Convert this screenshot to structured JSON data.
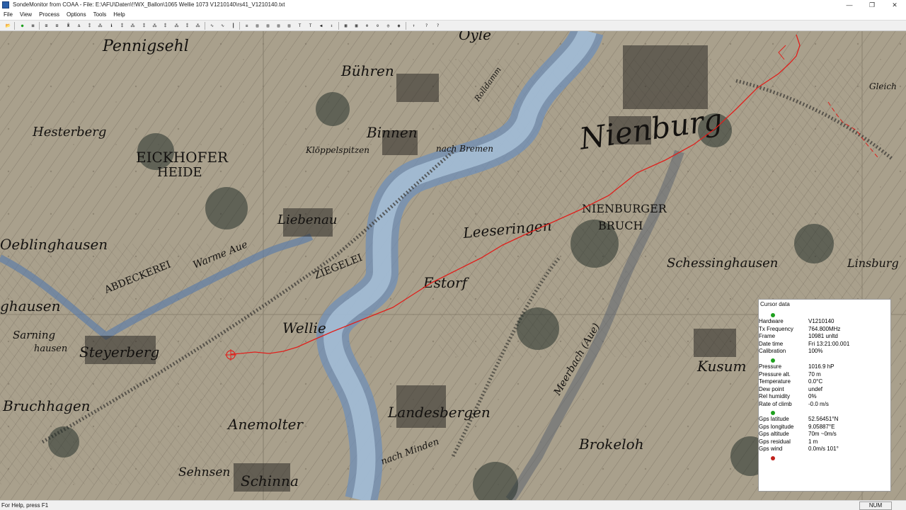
{
  "window": {
    "title": "SondeMonitor from COAA - File: E:\\AFU\\Daten\\!!WX_Ballon\\1065 Wellie 1073 V1210140\\rs41_V1210140.txt",
    "controls": [
      "—",
      "❐",
      "✕"
    ]
  },
  "menu": [
    "File",
    "View",
    "Process",
    "Options",
    "Tools",
    "Help"
  ],
  "toolbar": {
    "buttons": [
      {
        "name": "open",
        "glyph": "📂"
      },
      {
        "name": "start",
        "glyph": "●",
        "color": "#1fa01f"
      },
      {
        "name": "stop",
        "glyph": "■",
        "color": "#777777"
      },
      {
        "name": "view1",
        "glyph": "⊞"
      },
      {
        "name": "view2",
        "glyph": "⊞"
      },
      {
        "name": "view3",
        "glyph": "Ӂ"
      },
      {
        "name": "view4",
        "glyph": "Ѧ"
      },
      {
        "name": "view5",
        "glyph": "⁑"
      },
      {
        "name": "view6",
        "glyph": "⁂"
      },
      {
        "name": "view7",
        "glyph": "ℹ"
      },
      {
        "name": "view8",
        "glyph": "⁑"
      },
      {
        "name": "view9",
        "glyph": "⁂"
      },
      {
        "name": "view10",
        "glyph": "⁑"
      },
      {
        "name": "view11",
        "glyph": "⁂"
      },
      {
        "name": "view12",
        "glyph": "⁑"
      },
      {
        "name": "view13",
        "glyph": "⁂"
      },
      {
        "name": "view14",
        "glyph": "⁑"
      },
      {
        "name": "view15",
        "glyph": "⁂"
      },
      {
        "name": "wave",
        "glyph": "∿"
      },
      {
        "name": "wave2",
        "glyph": "∿"
      },
      {
        "name": "marker",
        "glyph": "┃"
      },
      {
        "name": "list",
        "glyph": "≡"
      },
      {
        "name": "grid",
        "glyph": "▤"
      },
      {
        "name": "grid2",
        "glyph": "▤"
      },
      {
        "name": "grid3",
        "glyph": "▤"
      },
      {
        "name": "grid4",
        "glyph": "▤"
      },
      {
        "name": "temp",
        "glyph": "T"
      },
      {
        "name": "temp2",
        "glyph": "T"
      },
      {
        "name": "sound",
        "glyph": "◀"
      },
      {
        "name": "scale",
        "glyph": "⇕"
      },
      {
        "name": "map",
        "glyph": "▦"
      },
      {
        "name": "map2",
        "glyph": "▦"
      },
      {
        "name": "zoom",
        "glyph": "⊕"
      },
      {
        "name": "zoom2",
        "glyph": "⊖"
      },
      {
        "name": "target",
        "glyph": "◎"
      },
      {
        "name": "globe",
        "glyph": "◉"
      },
      {
        "name": "up",
        "glyph": "↑"
      },
      {
        "name": "help",
        "glyph": "?"
      },
      {
        "name": "help2",
        "glyph": "?"
      }
    ]
  },
  "map_labels": [
    {
      "text": "Pennigsehl"
    },
    {
      "text": "Bühren"
    },
    {
      "text": "Binnen"
    },
    {
      "text": "Hesterberg"
    },
    {
      "text": "EICKHOFER"
    },
    {
      "text": "HEIDE"
    },
    {
      "text": "Klöppelspitzen"
    },
    {
      "text": "nach Bremen"
    },
    {
      "text": "Nienburg"
    },
    {
      "text": "Liebenau"
    },
    {
      "text": "Oeblinghausen"
    },
    {
      "text": "ABDECKEREI"
    },
    {
      "text": "Warme Aue"
    },
    {
      "text": "ZIEGELEI"
    },
    {
      "text": "Leeseringen"
    },
    {
      "text": "NIENBURGER"
    },
    {
      "text": "BRUCH"
    },
    {
      "text": "Schessinghausen"
    },
    {
      "text": "Linsburg"
    },
    {
      "text": "ghausen"
    },
    {
      "text": "Estorf"
    },
    {
      "text": "Wellie"
    },
    {
      "text": "Sarning"
    },
    {
      "text": "hausen"
    },
    {
      "text": "Steyerberg"
    },
    {
      "text": "Meerbach (Aue)"
    },
    {
      "text": "Kusum"
    },
    {
      "text": "Bruchhagen"
    },
    {
      "text": "Landesbergen"
    },
    {
      "text": "Anemolter"
    },
    {
      "text": "nach Minden"
    },
    {
      "text": "Brokeloh"
    },
    {
      "text": "Sehnsen"
    },
    {
      "text": "Schinna"
    },
    {
      "text": "Gleich"
    },
    {
      "text": "Rolldamm"
    },
    {
      "text": "Oyle"
    }
  ],
  "track_color": "#e0201c",
  "cursor_data": {
    "title": "Cursor data",
    "group1": [
      {
        "k": "Hardware",
        "v": "V1210140"
      },
      {
        "k": "Tx Frequency",
        "v": "764.800MHz"
      },
      {
        "k": "Frame",
        "v": "10981 unltd"
      },
      {
        "k": "Date time",
        "v": "Fri 13:21:00.001"
      },
      {
        "k": "Calibration",
        "v": "100%"
      }
    ],
    "group2": [
      {
        "k": "Pressure",
        "v": "1016.9 hP"
      },
      {
        "k": "Pressure alt.",
        "v": "70 m"
      },
      {
        "k": "Temperature",
        "v": "0.0°C"
      },
      {
        "k": "Dew point",
        "v": "undef"
      },
      {
        "k": "Rel humidity",
        "v": "0%"
      },
      {
        "k": "Rate of climb",
        "v": "-0.0 m/s"
      }
    ],
    "group3": [
      {
        "k": "Gps latitude",
        "v": "52.56451°N"
      },
      {
        "k": "Gps longitude",
        "v": "9.05887°E"
      },
      {
        "k": "Gps altitude",
        "v": "70m ~0m/s"
      },
      {
        "k": "Gps residual",
        "v": "1 m"
      },
      {
        "k": "Gps wind",
        "v": "0.0m/s 101°"
      }
    ],
    "status_colors": [
      "#1fa01f",
      "#1fa01f",
      "#1fa01f",
      "#c0201c"
    ]
  },
  "status": {
    "help_text": "For Help, press F1",
    "num": "NUM"
  }
}
